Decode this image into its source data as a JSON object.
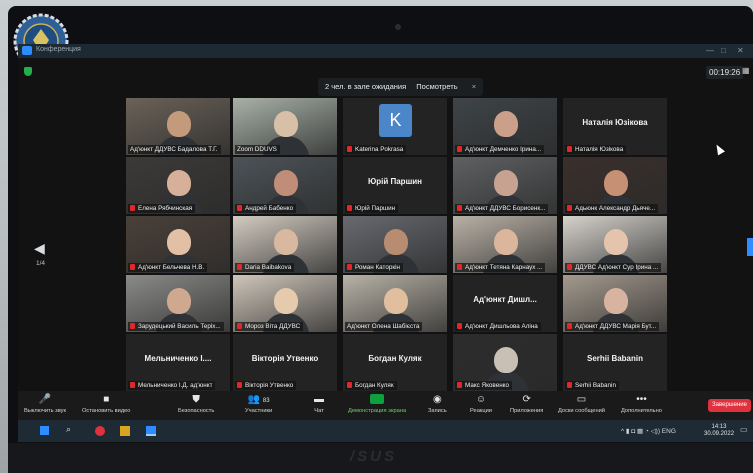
{
  "window": {
    "title": "Конференция"
  },
  "timer": "00:19:26",
  "waiting_room": {
    "text": "2 чел. в зале ожидания",
    "view_label": "Посмотреть",
    "close": "×"
  },
  "pagination": {
    "prev_icon": "◀",
    "page": "1/4"
  },
  "participants": [
    {
      "caption": "Ад'юнкт ДДУВС Бадалова Т.Г.",
      "muted": false,
      "display_name": ""
    },
    {
      "caption": "Zoom DDUVS",
      "muted": false,
      "display_name": "",
      "highlight": true
    },
    {
      "caption": "Katerina Pokrasa",
      "muted": true,
      "display_name": "",
      "avatar_letter": "K"
    },
    {
      "caption": "Ад'юнкт Демченко Ірина...",
      "muted": true,
      "display_name": ""
    },
    {
      "caption": "Наталія Юзікова",
      "muted": true,
      "display_name": "Наталія Юзікова"
    },
    {
      "caption": "Елена Рябчинская",
      "muted": true,
      "display_name": ""
    },
    {
      "caption": "Андрей Бабенко",
      "muted": true,
      "display_name": ""
    },
    {
      "caption": "Юрій Паршин",
      "muted": true,
      "display_name": "Юрій Паршин"
    },
    {
      "caption": "Ад'юнкт ДДУВС Борисенк...",
      "muted": true,
      "display_name": ""
    },
    {
      "caption": "Адьюнк Александр Дьяче...",
      "muted": true,
      "display_name": ""
    },
    {
      "caption": "Ад'юнкт Бельчева Н.В.",
      "muted": true,
      "display_name": ""
    },
    {
      "caption": "Daria Baibakova",
      "muted": true,
      "display_name": ""
    },
    {
      "caption": "Роман Каторкін",
      "muted": true,
      "display_name": ""
    },
    {
      "caption": "Ад'юнкт Тетяна Карнаух ...",
      "muted": true,
      "display_name": ""
    },
    {
      "caption": "ДДУВС Ад'юнкт Сур Ірина ...",
      "muted": true,
      "display_name": ""
    },
    {
      "caption": "Зарудецький Василь Теріх...",
      "muted": true,
      "display_name": ""
    },
    {
      "caption": "Мороз Віта ДДУВС",
      "muted": true,
      "display_name": ""
    },
    {
      "caption": "Ад'юнкт Олена Шабієста",
      "muted": false,
      "display_name": ""
    },
    {
      "caption": "Ад'юнкт Дишльова Аліна",
      "muted": true,
      "display_name": "Ад'юнкт Дишл..."
    },
    {
      "caption": "Ад'юнкт ДДУВС Марія Бут...",
      "muted": true,
      "display_name": ""
    },
    {
      "caption": "Мельниченко І.Д. ад'юнкт",
      "muted": true,
      "display_name": "Мельниченко І...."
    },
    {
      "caption": "Вікторія Утвенко",
      "muted": true,
      "display_name": "Вікторія Утвенко"
    },
    {
      "caption": "Богдан Куляк",
      "muted": true,
      "display_name": "Богдан Куляк"
    },
    {
      "caption": "Макс Яковенко",
      "muted": true,
      "display_name": ""
    },
    {
      "caption": "Serhii Babanin",
      "muted": true,
      "display_name": "Serhii Babanin"
    }
  ],
  "toolbar": {
    "mute": "Выключить звук",
    "video": "Остановить видео",
    "security": "Безопасность",
    "participants": "Участники",
    "participants_count": "83",
    "chat": "Чат",
    "share": "Демонстрация экрана",
    "record": "Запись",
    "reactions": "Реакции",
    "apps": "Приложения",
    "whiteboards": "Доски сообщений",
    "more": "Дополнительно",
    "end": "Завершение"
  },
  "taskbar": {
    "lang": "ENG",
    "time": "14:13",
    "date": "30.09.2022"
  },
  "brand": "/SUS",
  "colors": {
    "accent": "#2d8cff",
    "share_green": "#0e9f3e",
    "end_red": "#e0313e",
    "muted_red": "#e02828",
    "active_speaker": "#d2e64a"
  }
}
